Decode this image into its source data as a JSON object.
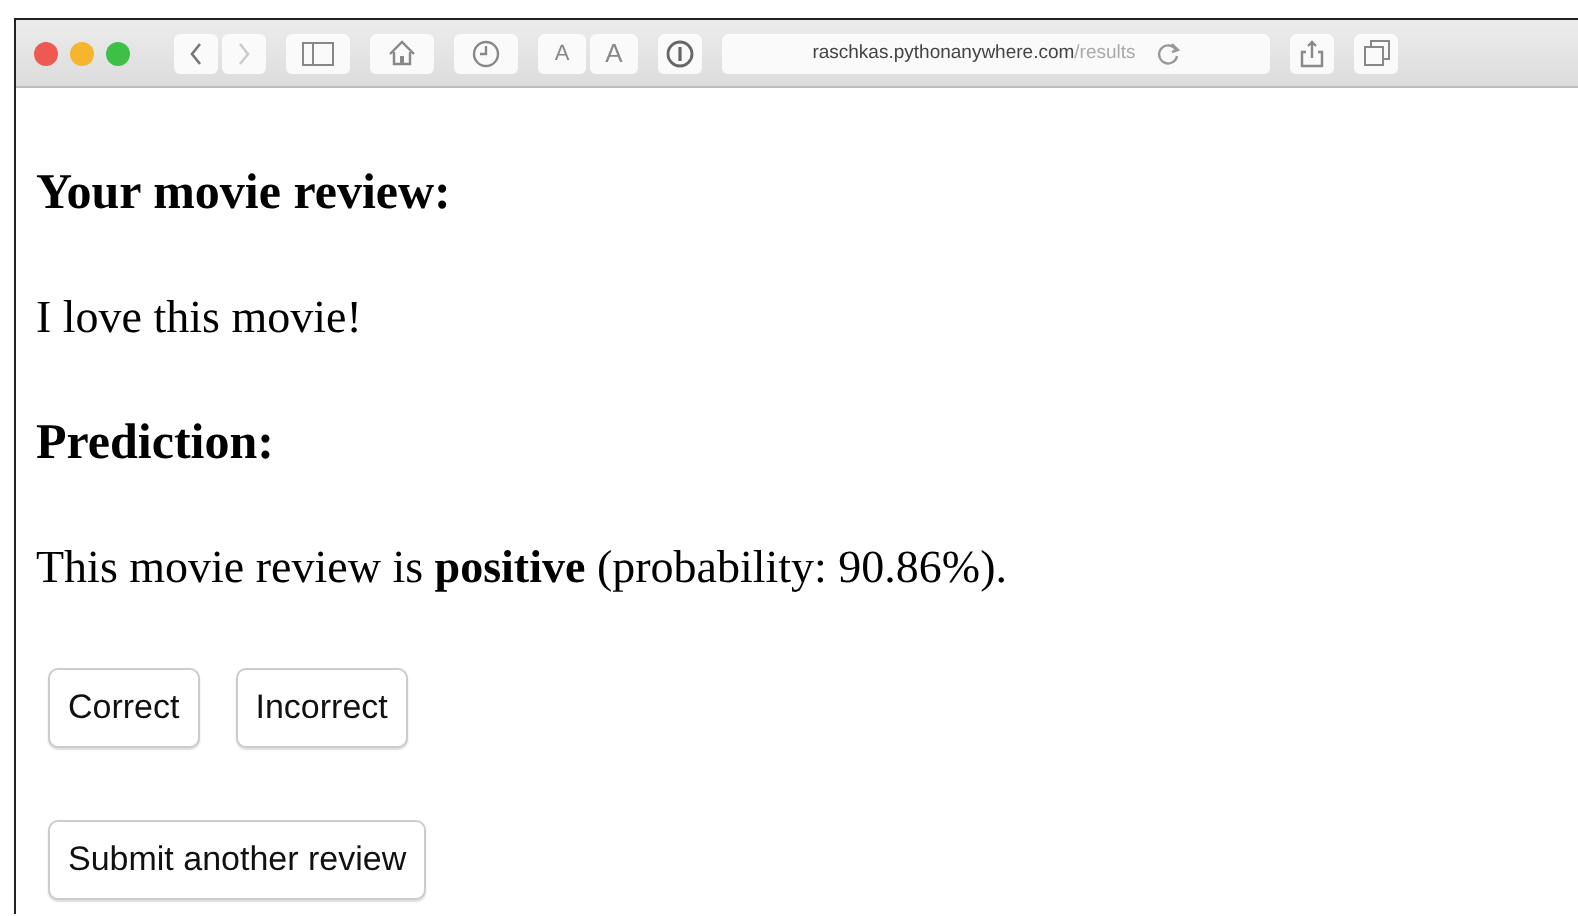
{
  "browser": {
    "text_size_buttons": [
      "A",
      "A"
    ],
    "url_host": "raschkas.pythonanywhere.com",
    "url_path": "/results"
  },
  "page": {
    "review_heading": "Your movie review:",
    "review_text": "I love this movie!",
    "prediction_heading": "Prediction:",
    "prediction_text": "This movie review is **positive** (probability: 90.86%).",
    "feedback_buttons": [
      "Correct",
      "Incorrect"
    ],
    "submit_button": "Submit another review"
  }
}
